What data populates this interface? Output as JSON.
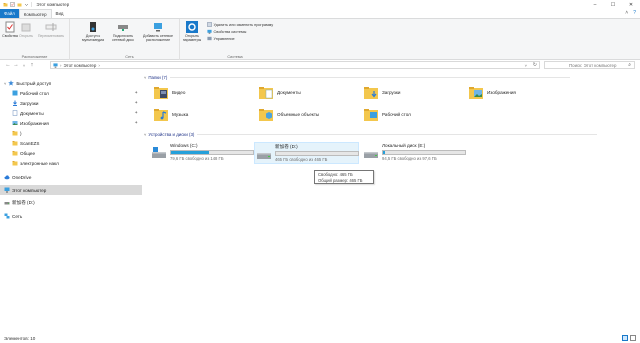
{
  "window": {
    "title": "Этот компьютер"
  },
  "tabs": [
    {
      "label": "Файл"
    },
    {
      "label": "Компьютер"
    },
    {
      "label": "Вид"
    }
  ],
  "ribbon": {
    "properties": "Свойства",
    "open": "Открыть",
    "rename": "Переименовать",
    "group_location": "Расположение",
    "media_access": "Доступ к мультимедиа",
    "map_drive": "Подключить сетевой диск",
    "add_location": "Добавить сетевое расположение",
    "group_network": "Сеть",
    "open_settings": "Открыть параметры",
    "uninstall": "Удалить или изменить программу",
    "system_props": "Свойства системы",
    "manage": "Управление",
    "group_system": "Система"
  },
  "address": {
    "crumb": "Этот компьютер",
    "search_placeholder": "Поиск: Этот компьютер"
  },
  "sidebar": {
    "items": [
      {
        "label": "Быстрый доступ",
        "icon": "star-icon"
      },
      {
        "label": "Рабочий стол",
        "icon": "desktop-icon",
        "pinned": true
      },
      {
        "label": "Загрузки",
        "icon": "download-icon",
        "pinned": true
      },
      {
        "label": "Документы",
        "icon": "documents-icon",
        "pinned": true
      },
      {
        "label": "Изображения",
        "icon": "pictures-icon",
        "pinned": true
      },
      {
        "label": ")",
        "icon": "folder-icon"
      },
      {
        "label": "ScanEZS",
        "icon": "folder-icon"
      },
      {
        "label": "Общее",
        "icon": "folder-icon"
      },
      {
        "label": "электронные накл",
        "icon": "folder-icon"
      },
      {
        "label": "OneDrive",
        "icon": "cloud-icon"
      },
      {
        "label": "Этот компьютер",
        "icon": "pc-icon"
      },
      {
        "label": "新加卷 (D:)",
        "icon": "drive-icon"
      },
      {
        "label": "Сеть",
        "icon": "network-icon"
      }
    ]
  },
  "folders_section": {
    "header": "Папки (7)",
    "items": [
      {
        "label": "Видео"
      },
      {
        "label": "Документы"
      },
      {
        "label": "Загрузки"
      },
      {
        "label": "Изображения"
      },
      {
        "label": "Музыка"
      },
      {
        "label": "Объемные объекты"
      },
      {
        "label": "Рабочий стол"
      }
    ]
  },
  "drives_section": {
    "header": "Устройства и диски (3)",
    "items": [
      {
        "name": "Windows (C:)",
        "free": "79,6 ГБ свободно из 148 ГБ",
        "used_fraction": 0.46
      },
      {
        "name": "新加卷 (D:)",
        "free": "465 ГБ свободно из 465 ГБ",
        "used_fraction": 0.0
      },
      {
        "name": "Локальный диск (E:)",
        "free": "94,5 ГБ свободно из 97,6 ГБ",
        "used_fraction": 0.03
      }
    ]
  },
  "tooltip": {
    "line1": "Свободно: 465 ГБ",
    "line2": "Общий размер: 465 ГБ"
  },
  "status": {
    "count": "Элементов: 10"
  },
  "colors": {
    "accent": "#1979ca",
    "bar_fill": "#26a0da",
    "selection": "#d9d9d9",
    "folder": "#f3c74d"
  }
}
